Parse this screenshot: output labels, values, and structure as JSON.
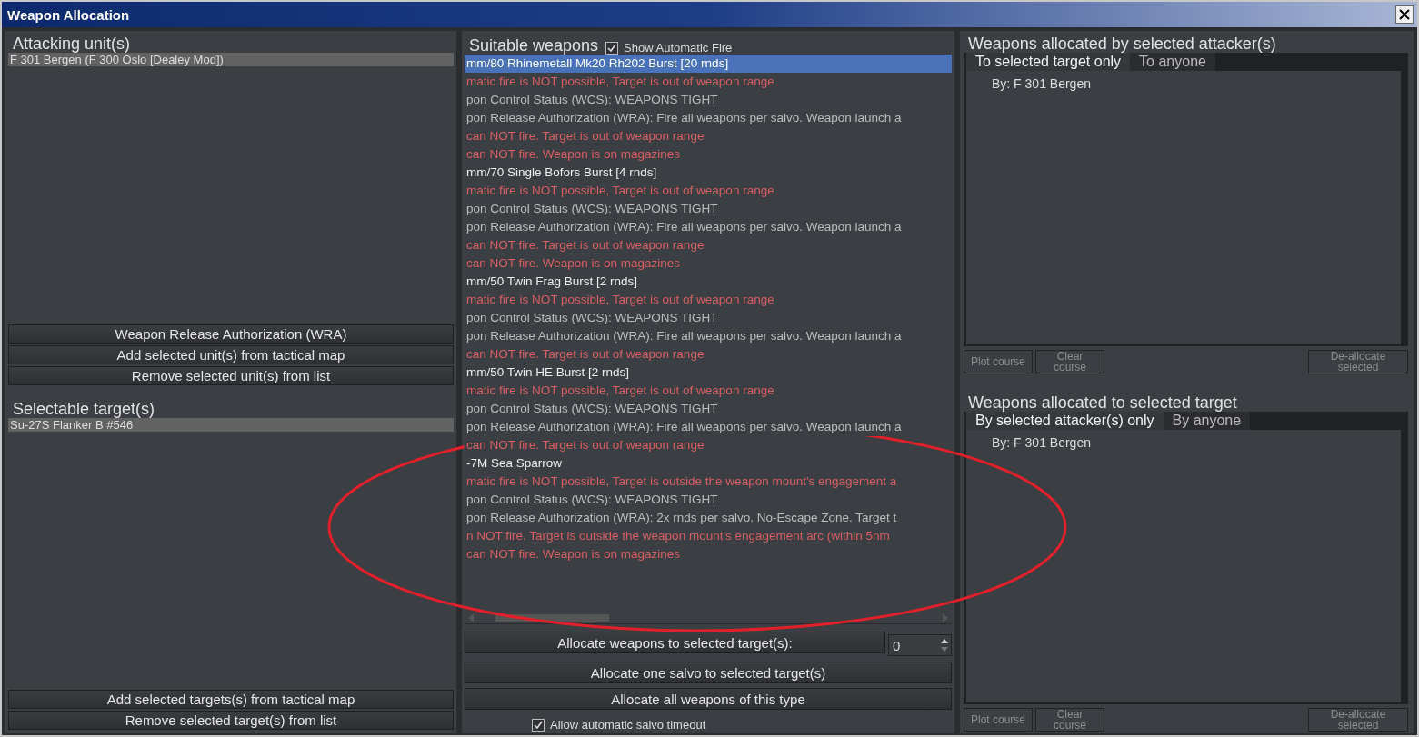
{
  "window": {
    "title": "Weapon Allocation"
  },
  "attackers": {
    "title": "Attacking unit(s)",
    "items": [
      {
        "label": "F 301 Bergen (F 300 Oslo [Dealey Mod])",
        "selected": true
      }
    ],
    "buttons": [
      "Weapon Release Authorization (WRA)",
      "Add selected unit(s) from tactical map",
      "Remove selected unit(s) from list"
    ]
  },
  "targets": {
    "title": "Selectable target(s)",
    "items": [
      {
        "label": "Su-27S Flanker B #546",
        "selected": true
      }
    ],
    "buttons": [
      "Add selected targets(s) from tactical map",
      "Remove selected target(s) from list"
    ]
  },
  "weapons": {
    "title": "Suitable weapons",
    "show_automatic_fire": {
      "label": "Show Automatic Fire",
      "checked": true
    },
    "rows": [
      {
        "kind": "weapon",
        "text": "mm/80 Rhinemetall Mk20 Rh202 Burst [20 rnds]",
        "selected": true
      },
      {
        "kind": "error",
        "text": "matic fire is NOT possible, Target is out of weapon range",
        "selected": false
      },
      {
        "kind": "info",
        "text": "pon Control Status (WCS): WEAPONS TIGHT",
        "selected": false
      },
      {
        "kind": "info",
        "text": "pon Release Authorization (WRA): Fire all weapons per salvo. Weapon launch a",
        "selected": false
      },
      {
        "kind": "error",
        "text": "can NOT fire. Target is out of weapon range",
        "selected": false
      },
      {
        "kind": "error",
        "text": "can NOT fire. Weapon is on magazines",
        "selected": false
      },
      {
        "kind": "weapon",
        "text": "mm/70 Single Bofors Burst [4 rnds]",
        "selected": false
      },
      {
        "kind": "error",
        "text": "matic fire is NOT possible, Target is out of weapon range",
        "selected": false
      },
      {
        "kind": "info",
        "text": "pon Control Status (WCS): WEAPONS TIGHT",
        "selected": false
      },
      {
        "kind": "info",
        "text": "pon Release Authorization (WRA): Fire all weapons per salvo. Weapon launch a",
        "selected": false
      },
      {
        "kind": "error",
        "text": "can NOT fire. Target is out of weapon range",
        "selected": false
      },
      {
        "kind": "error",
        "text": "can NOT fire. Weapon is on magazines",
        "selected": false
      },
      {
        "kind": "weapon",
        "text": "mm/50 Twin Frag Burst [2 rnds]",
        "selected": false
      },
      {
        "kind": "error",
        "text": "matic fire is NOT possible, Target is out of weapon range",
        "selected": false
      },
      {
        "kind": "info",
        "text": "pon Control Status (WCS): WEAPONS TIGHT",
        "selected": false
      },
      {
        "kind": "info",
        "text": "pon Release Authorization (WRA): Fire all weapons per salvo. Weapon launch a",
        "selected": false
      },
      {
        "kind": "error",
        "text": "can NOT fire. Target is out of weapon range",
        "selected": false
      },
      {
        "kind": "weapon",
        "text": "mm/50 Twin HE Burst [2 rnds]",
        "selected": false
      },
      {
        "kind": "error",
        "text": "matic fire is NOT possible, Target is out of weapon range",
        "selected": false
      },
      {
        "kind": "info",
        "text": "pon Control Status (WCS): WEAPONS TIGHT",
        "selected": false
      },
      {
        "kind": "info",
        "text": "pon Release Authorization (WRA): Fire all weapons per salvo. Weapon launch a",
        "selected": false
      },
      {
        "kind": "error",
        "text": "can NOT fire. Target is out of weapon range",
        "selected": false
      },
      {
        "kind": "weapon",
        "text": "-7M Sea Sparrow",
        "selected": false
      },
      {
        "kind": "error",
        "text": "matic fire is NOT possible, Target is outside the weapon mount's engagement a",
        "selected": false
      },
      {
        "kind": "info",
        "text": "pon Control Status (WCS): WEAPONS TIGHT",
        "selected": false
      },
      {
        "kind": "info",
        "text": "pon Release Authorization (WRA): 2x rnds per salvo. No-Escape Zone.  Target t",
        "selected": false
      },
      {
        "kind": "error",
        "text": "n NOT fire. Target is outside the weapon mount's engagement arc (within 5nm",
        "selected": false
      },
      {
        "kind": "error",
        "text": "can NOT fire. Weapon is on magazines",
        "selected": false
      }
    ],
    "allocate_count": {
      "label": "Allocate weapons to selected target(s):",
      "value": "0"
    },
    "buttons": [
      "Allocate one salvo to selected target(s)",
      "Allocate all weapons of this type"
    ],
    "salvo_timeout": {
      "label": "Allow automatic salvo timeout",
      "checked": true
    }
  },
  "by_attacker": {
    "title": "Weapons allocated by selected attacker(s)",
    "tabs": [
      {
        "label": "To selected target only",
        "selected": true
      },
      {
        "label": "To anyone",
        "selected": false
      }
    ],
    "items": [
      "By: F 301 Bergen"
    ],
    "buttons": [
      {
        "label": "Plot course",
        "disabled": true
      },
      {
        "label": "Clear course",
        "disabled": true
      },
      {
        "label": "De-allocate selected",
        "disabled": true
      }
    ]
  },
  "to_target": {
    "title": "Weapons allocated to selected target",
    "tabs": [
      {
        "label": "By selected attacker(s) only",
        "selected": true
      },
      {
        "label": "By anyone",
        "selected": false
      }
    ],
    "items": [
      "By: F 301 Bergen"
    ],
    "buttons": [
      {
        "label": "Plot course",
        "disabled": true
      },
      {
        "label": "Clear course",
        "disabled": true
      },
      {
        "label": "De-allocate selected",
        "disabled": true
      }
    ]
  }
}
